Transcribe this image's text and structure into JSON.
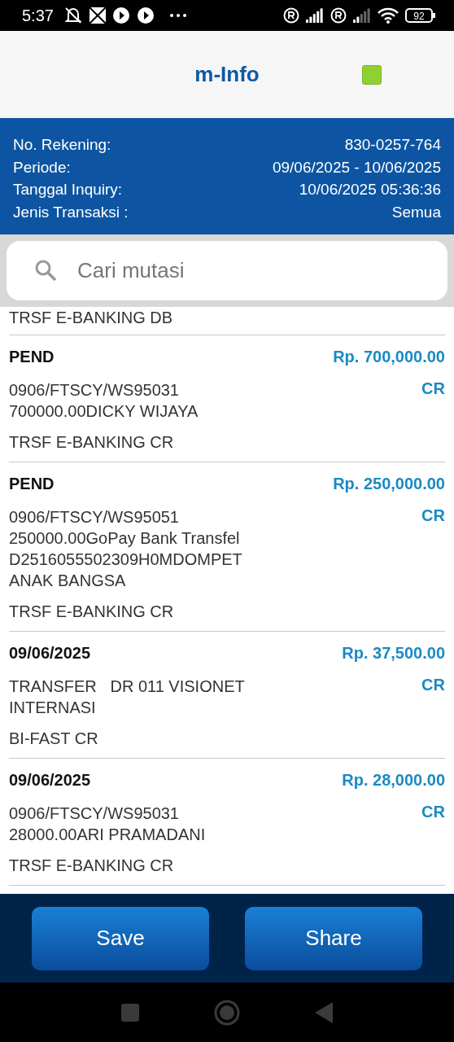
{
  "status_bar": {
    "time": "5:37",
    "battery": "92"
  },
  "header": {
    "title": "m-Info"
  },
  "account_info": [
    {
      "label": "No. Rekening:",
      "value": "830-0257-764"
    },
    {
      "label": "Periode:",
      "value": "09/06/2025 - 10/06/2025"
    },
    {
      "label": "Tanggal Inquiry:",
      "value": "10/06/2025 05:36:36"
    },
    {
      "label": "Jenis Transaksi :",
      "value": "Semua"
    }
  ],
  "search": {
    "placeholder": "Cari mutasi"
  },
  "partial_item": {
    "channel": "TRSF E-BANKING DB"
  },
  "transactions": [
    {
      "date": "PEND",
      "amount": "Rp. 700,000.00",
      "description": "0906/FTSCY/WS95031\n700000.00DICKY WIJAYA",
      "type": "CR",
      "channel": "TRSF E-BANKING CR"
    },
    {
      "date": "PEND",
      "amount": "Rp. 250,000.00",
      "description": "0906/FTSCY/WS95051\n250000.00GoPay Bank Transfel\nD2516055502309H0MDOMPET\nANAK BANGSA",
      "type": "CR",
      "channel": "TRSF E-BANKING CR"
    },
    {
      "date": "09/06/2025",
      "amount": "Rp. 37,500.00",
      "description": "TRANSFER   DR 011 VISIONET\nINTERNASI",
      "type": "CR",
      "channel": "BI-FAST CR"
    },
    {
      "date": "09/06/2025",
      "amount": "Rp. 28,000.00",
      "description": "0906/FTSCY/WS95031\n28000.00ARI PRAMADANI",
      "type": "CR",
      "channel": "TRSF E-BANKING CR"
    }
  ],
  "buttons": [
    {
      "label": "Save"
    },
    {
      "label": "Share"
    }
  ]
}
